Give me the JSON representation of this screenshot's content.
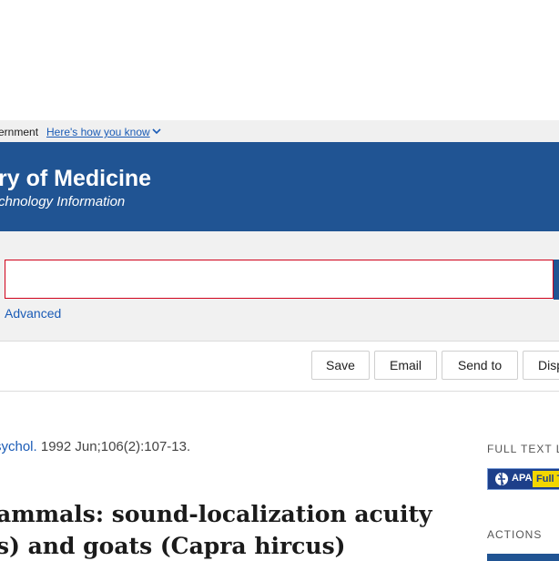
{
  "gov_banner": {
    "text": "ernment",
    "link": "Here's how you know"
  },
  "header": {
    "title": "ry of Medicine",
    "subtitle": "chnology Information"
  },
  "search": {
    "value": "",
    "advanced_label": "Advanced"
  },
  "toolbar": {
    "save_label": "Save",
    "email_label": "Email",
    "send_to_label": "Send to",
    "display_label": "Disp"
  },
  "article": {
    "journal": "sychol.",
    "citation_rest": " 1992 Jun;106(2):107-13.",
    "title_line1": "ammals: sound-localization acuity",
    "title_line2": "s) and goats (Capra hircus)"
  },
  "sidebar": {
    "full_text_heading": "FULL TEXT LI",
    "apa_label": "APA",
    "apa_fulltext_label": "Full T",
    "actions_heading": "ACTIONS"
  },
  "colors": {
    "header_bg": "#205493",
    "link": "#1a5bb6",
    "error_border": "#d0021b",
    "apa_badge_bg": "#1d3f8a",
    "apa_badge_highlight": "#f2d600"
  },
  "icons": {
    "gov_chevron": "chevron-down-icon",
    "apa_logo": "globe-icon"
  }
}
